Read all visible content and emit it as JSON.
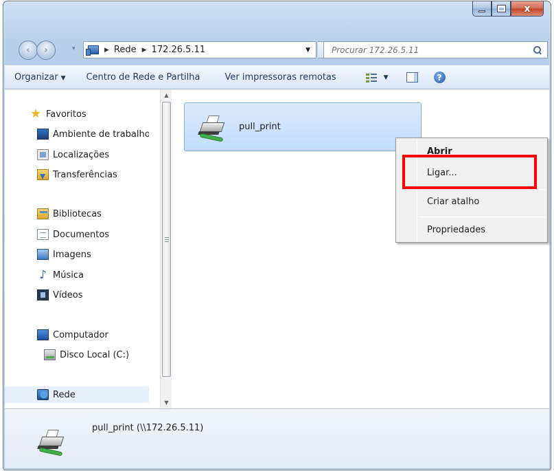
{
  "window": {
    "close_glyph": "x"
  },
  "nav": {
    "back_glyph": "‹",
    "forward_glyph": "›",
    "recent_glyph": "▾"
  },
  "address": {
    "crumbs": [
      "Rede",
      "172.26.5.11"
    ],
    "crumb_separator": "▶",
    "dropdown_glyph": "▼",
    "refresh_glyph": "↯"
  },
  "search": {
    "placeholder": "Procurar 172.26.5.11"
  },
  "toolbar": {
    "organize_label": "Organizar",
    "dropdown_glyph": "▼",
    "network_center_label": "Centro de Rede e Partilha",
    "remote_printers_label": "Ver impressoras remotas",
    "help_glyph": "?"
  },
  "sidebar": {
    "favorites": {
      "header": "Favoritos",
      "items": [
        "Ambiente de trabalho",
        "Localizações",
        "Transferências"
      ]
    },
    "libraries": {
      "header": "Bibliotecas",
      "items": [
        "Documentos",
        "Imagens",
        "Música",
        "Vídeos"
      ]
    },
    "computer": {
      "header": "Computador",
      "items": [
        "Disco Local (C:)"
      ]
    },
    "network": {
      "header": "Rede"
    },
    "scroll_up_glyph": "▲",
    "scroll_down_glyph": "▼"
  },
  "content": {
    "items": [
      {
        "name": "pull_print",
        "selected": true
      }
    ]
  },
  "context_menu": {
    "items": [
      "Abrir",
      "Ligar...",
      "Criar atalho",
      "Propriedades"
    ],
    "default_item": "Abrir",
    "highlighted_item": "Ligar..."
  },
  "details": {
    "label": "pull_print (\\\\172.26.5.11)"
  },
  "colors": {
    "highlight_border": "#ff0000",
    "selection_bg": "#c1dcfc",
    "selection_border": "#84acdd"
  }
}
